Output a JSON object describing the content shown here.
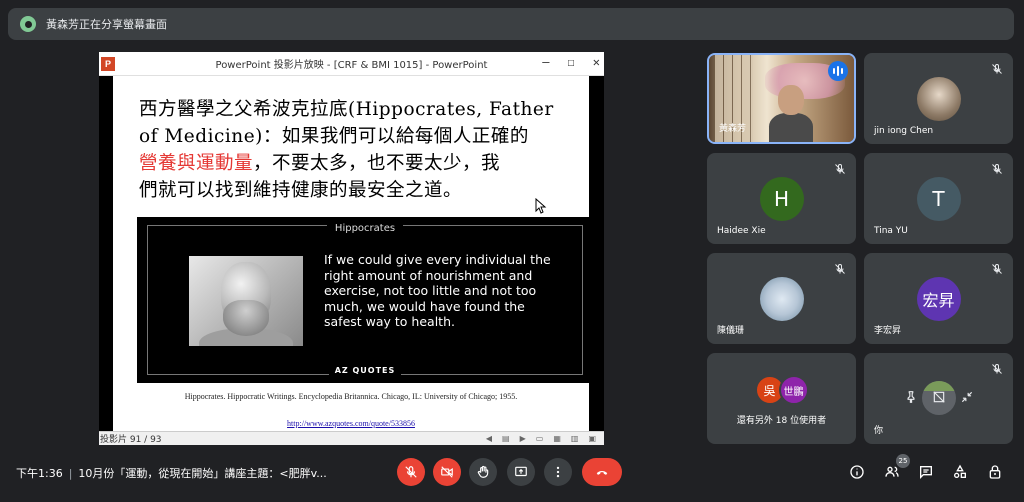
{
  "banner": {
    "text": "黃森芳正在分享螢幕畫面"
  },
  "ppt": {
    "window_title": "PowerPoint 投影片放映 - [CRF & BMI 1015] - PowerPoint",
    "app_icon": "P",
    "min": "—",
    "max": "☐",
    "close": "✕",
    "slide": {
      "line1": "西方醫學之父希波克拉底(Hippocrates, Father",
      "line2": "of Medicine)：如果我們可以給每個人正確的",
      "line3_red": "營養與運動量",
      "line3_rest": "，不要太多，也不要太少，我",
      "line4": "們就可以找到維持健康的最安全之道。",
      "quote_header": "Hippocrates",
      "quote_text": "If we could give every individual the right amount of nourishment and exercise, not too little and not too much, we would have found the safest way to health.",
      "quote_footer": "AZ QUOTES",
      "citation": "Hippocrates. Hippocratic Writings. Encyclopedia Britannica. Chicago, IL: University of Chicago; 1955.",
      "link": "http://www.azquotes.com/quote/533856"
    },
    "status": "投影片 91 / 93"
  },
  "participants": [
    {
      "name": "黃森芳",
      "type": "video"
    },
    {
      "name": "jin iong Chen",
      "type": "photo"
    },
    {
      "name": "Haidee Xie",
      "initial": "H",
      "color": "#33691e"
    },
    {
      "name": "Tina YU",
      "initial": "T",
      "color": "#455a64"
    },
    {
      "name": "陳儀珊",
      "type": "photo"
    },
    {
      "name": "李宏昇",
      "initial": "宏昇",
      "color": "#5e35b1"
    }
  ],
  "others": {
    "a_initial": "吳",
    "a_color": "#d84315",
    "b_initial": "世鵬",
    "b_color": "#8e24aa",
    "label": "還有另外 18 位使用者"
  },
  "self": {
    "name": "你"
  },
  "bottom": {
    "time": "下午1:36",
    "meeting": "10月份「運動，從現在開始」講座主題：<肥胖v...",
    "people_count": "25"
  },
  "colors": {
    "end_call": "#ea4335",
    "accent": "#8ab4f8"
  }
}
